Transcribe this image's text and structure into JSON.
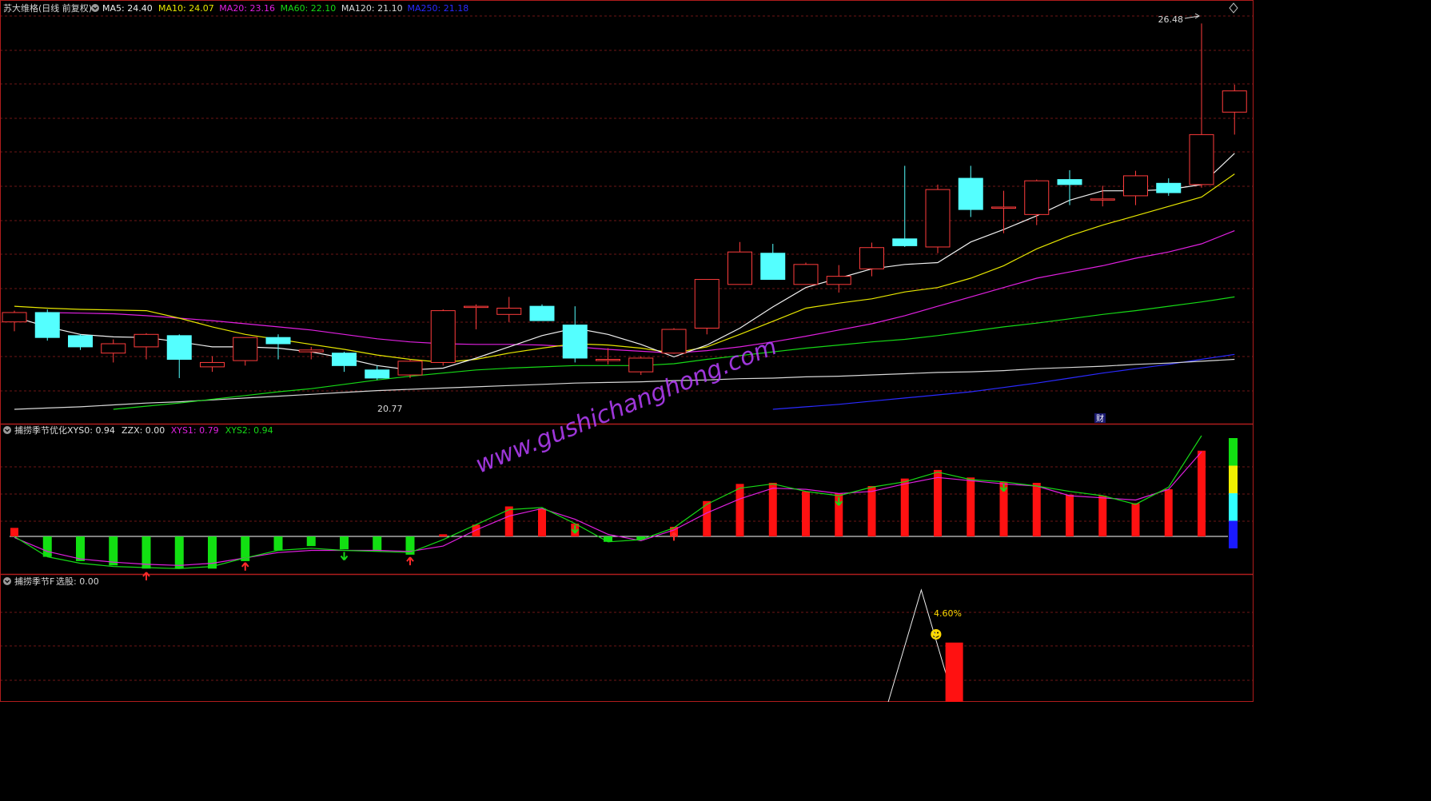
{
  "colors": {
    "background": "#000000",
    "frame": "#b01c1c",
    "grid": "#6e1616",
    "up": "#ff3c3c",
    "down": "#54ffff",
    "ma5": "#f0f0f0",
    "ma10": "#e6e600",
    "ma20": "#e020e0",
    "ma60": "#16d916",
    "ma120": "#d8d8d8",
    "ma250": "#2a2aff",
    "header": "#d8d8d8",
    "xys1": "#e020e0",
    "xys2": "#16d916",
    "green_bar": "#12e012",
    "red_bar": "#ff1111",
    "arrow_up": "#ff2a2a",
    "arrow_down": "#16d916",
    "gauge": [
      "#12e012",
      "#f0f000",
      "#30ffff",
      "#1a1aff"
    ],
    "watermark": "#b940ff",
    "smiley": "#ffd900",
    "pct": "#ffd900"
  },
  "header": {
    "name": "苏大维格(日线 前复权)",
    "ma_labels": [
      {
        "label": "MA5: 24.40",
        "color": "#f0f0f0"
      },
      {
        "label": "MA10: 24.07",
        "color": "#e6e600"
      },
      {
        "label": "MA20: 23.16",
        "color": "#e020e0"
      },
      {
        "label": "MA60: 22.10",
        "color": "#16d916"
      },
      {
        "label": "MA120: 21.10",
        "color": "#d8d8d8"
      },
      {
        "label": "MA250: 21.18",
        "color": "#2a2aff"
      }
    ]
  },
  "indicator1": {
    "name": "捕捞季节优化",
    "labels": [
      {
        "label": "XYS0: 0.94",
        "color": "#e0e0e0"
      },
      {
        "label": "ZZX: 0.00",
        "color": "#e0e0e0"
      },
      {
        "label": "XYS1: 0.79",
        "color": "#e020e0"
      },
      {
        "label": "XYS2: 0.94",
        "color": "#16d916"
      }
    ]
  },
  "indicator2": {
    "name": "捕捞季节F",
    "label": "选股: 0.00",
    "pct_label": "4.60%",
    "smiley": "☻"
  },
  "annotations": {
    "high_label": "26.48",
    "low_label": "20.77",
    "cai_badge": "财"
  },
  "watermark": "www.gushichanghong.com",
  "chart_data": [
    {
      "type": "candlestick",
      "title": "苏大维格(日线 前复权)",
      "ylim": [
        20.3,
        26.6
      ],
      "candles": [
        {
          "o": 21.7,
          "h": 21.88,
          "l": 21.55,
          "c": 21.85
        },
        {
          "o": 21.85,
          "h": 21.9,
          "l": 21.4,
          "c": 21.45
        },
        {
          "o": 21.48,
          "h": 21.5,
          "l": 21.25,
          "c": 21.3
        },
        {
          "o": 21.2,
          "h": 21.42,
          "l": 21.05,
          "c": 21.35
        },
        {
          "o": 21.3,
          "h": 21.52,
          "l": 21.1,
          "c": 21.5
        },
        {
          "o": 21.48,
          "h": 21.5,
          "l": 20.8,
          "c": 21.1
        },
        {
          "o": 20.98,
          "h": 21.15,
          "l": 20.9,
          "c": 21.05
        },
        {
          "o": 21.08,
          "h": 21.45,
          "l": 21.0,
          "c": 21.45
        },
        {
          "o": 21.45,
          "h": 21.5,
          "l": 21.1,
          "c": 21.35
        },
        {
          "o": 21.22,
          "h": 21.3,
          "l": 21.1,
          "c": 21.25
        },
        {
          "o": 21.2,
          "h": 21.22,
          "l": 20.9,
          "c": 21.0
        },
        {
          "o": 20.93,
          "h": 21.0,
          "l": 20.77,
          "c": 20.8
        },
        {
          "o": 20.85,
          "h": 21.1,
          "l": 20.8,
          "c": 21.07
        },
        {
          "o": 21.05,
          "h": 21.9,
          "l": 21.0,
          "c": 21.88
        },
        {
          "o": 21.95,
          "h": 21.98,
          "l": 21.58,
          "c": 21.95
        },
        {
          "o": 21.82,
          "h": 22.1,
          "l": 21.7,
          "c": 21.92
        },
        {
          "o": 21.95,
          "h": 21.98,
          "l": 21.72,
          "c": 21.72
        },
        {
          "o": 21.65,
          "h": 21.95,
          "l": 21.05,
          "c": 21.12
        },
        {
          "o": 21.08,
          "h": 21.28,
          "l": 21.02,
          "c": 21.1
        },
        {
          "o": 20.9,
          "h": 21.15,
          "l": 20.85,
          "c": 21.12
        },
        {
          "o": 21.2,
          "h": 21.6,
          "l": 21.2,
          "c": 21.58
        },
        {
          "o": 21.6,
          "h": 22.38,
          "l": 21.5,
          "c": 22.38
        },
        {
          "o": 22.3,
          "h": 22.98,
          "l": 22.3,
          "c": 22.82
        },
        {
          "o": 22.8,
          "h": 22.95,
          "l": 22.38,
          "c": 22.38
        },
        {
          "o": 22.3,
          "h": 22.65,
          "l": 22.3,
          "c": 22.62
        },
        {
          "o": 22.3,
          "h": 22.61,
          "l": 22.17,
          "c": 22.43
        },
        {
          "o": 22.55,
          "h": 22.97,
          "l": 22.43,
          "c": 22.89
        },
        {
          "o": 23.03,
          "h": 24.2,
          "l": 22.9,
          "c": 22.92
        },
        {
          "o": 22.9,
          "h": 23.9,
          "l": 22.8,
          "c": 23.82
        },
        {
          "o": 24.0,
          "h": 24.2,
          "l": 23.38,
          "c": 23.5
        },
        {
          "o": 23.53,
          "h": 23.8,
          "l": 23.12,
          "c": 23.54
        },
        {
          "o": 23.42,
          "h": 23.98,
          "l": 23.25,
          "c": 23.96
        },
        {
          "o": 23.98,
          "h": 24.13,
          "l": 23.57,
          "c": 23.9
        },
        {
          "o": 23.67,
          "h": 23.88,
          "l": 23.55,
          "c": 23.67
        },
        {
          "o": 23.72,
          "h": 24.12,
          "l": 23.57,
          "c": 24.04
        },
        {
          "o": 23.92,
          "h": 24.0,
          "l": 23.72,
          "c": 23.77
        },
        {
          "o": 23.9,
          "h": 26.48,
          "l": 23.85,
          "c": 24.7
        },
        {
          "o": 25.06,
          "h": 25.5,
          "l": 24.7,
          "c": 25.4
        }
      ],
      "ma5": [
        21.78,
        21.62,
        21.5,
        21.46,
        21.45,
        21.38,
        21.3,
        21.3,
        21.28,
        21.22,
        21.12,
        21.0,
        20.93,
        20.96,
        21.12,
        21.3,
        21.48,
        21.6,
        21.5,
        21.34,
        21.14,
        21.33,
        21.6,
        21.94,
        22.25,
        22.4,
        22.55,
        22.62,
        22.65,
        22.98,
        23.18,
        23.4,
        23.65,
        23.8,
        23.8,
        23.82,
        23.9,
        24.4
      ],
      "ma10": [
        21.95,
        21.92,
        21.9,
        21.89,
        21.88,
        21.76,
        21.62,
        21.5,
        21.42,
        21.34,
        21.26,
        21.17,
        21.1,
        21.05,
        21.1,
        21.2,
        21.28,
        21.35,
        21.33,
        21.28,
        21.2,
        21.3,
        21.5,
        21.71,
        21.92,
        22.0,
        22.07,
        22.18,
        22.25,
        22.4,
        22.6,
        22.87,
        23.08,
        23.25,
        23.4,
        23.55,
        23.7,
        24.07
      ],
      "ma20": [
        null,
        21.85,
        21.84,
        21.83,
        21.8,
        21.76,
        21.72,
        21.67,
        21.62,
        21.57,
        21.5,
        21.43,
        21.38,
        21.35,
        21.34,
        21.34,
        21.33,
        21.3,
        21.26,
        21.23,
        21.2,
        21.24,
        21.3,
        21.38,
        21.47,
        21.57,
        21.67,
        21.8,
        21.95,
        22.1,
        22.25,
        22.4,
        22.5,
        22.6,
        22.72,
        22.82,
        22.95,
        23.16
      ],
      "ma60": [
        null,
        null,
        null,
        20.3,
        20.35,
        20.4,
        20.46,
        20.52,
        20.58,
        20.63,
        20.7,
        20.77,
        20.83,
        20.88,
        20.93,
        20.96,
        20.98,
        21.0,
        21.0,
        21.0,
        21.03,
        21.1,
        21.16,
        21.22,
        21.28,
        21.33,
        21.38,
        21.42,
        21.48,
        21.55,
        21.62,
        21.68,
        21.75,
        21.82,
        21.88,
        21.95,
        22.02,
        22.1
      ],
      "ma120": [
        20.3,
        20.32,
        20.34,
        20.37,
        20.4,
        20.42,
        20.45,
        20.48,
        20.51,
        20.54,
        20.57,
        20.6,
        20.62,
        20.64,
        20.66,
        20.68,
        20.7,
        20.72,
        20.73,
        20.74,
        20.76,
        20.77,
        20.79,
        20.8,
        20.82,
        20.83,
        20.85,
        20.87,
        20.89,
        20.9,
        20.92,
        20.95,
        20.97,
        20.99,
        21.02,
        21.04,
        21.07,
        21.1
      ],
      "ma250": [
        null,
        null,
        null,
        null,
        null,
        null,
        null,
        null,
        null,
        null,
        null,
        null,
        null,
        null,
        null,
        null,
        null,
        null,
        null,
        null,
        null,
        null,
        null,
        20.3,
        20.34,
        20.38,
        20.43,
        20.48,
        20.53,
        20.58,
        20.65,
        20.72,
        20.8,
        20.88,
        20.95,
        21.02,
        21.1,
        21.18
      ]
    },
    {
      "type": "bar",
      "title": "捕捞季节优化",
      "ylim": [
        -0.35,
        0.94
      ],
      "bars": [
        0.08,
        -0.19,
        -0.23,
        -0.27,
        -0.3,
        -0.3,
        -0.3,
        -0.23,
        -0.13,
        -0.09,
        -0.12,
        -0.14,
        -0.17,
        0.02,
        0.11,
        0.28,
        0.26,
        0.12,
        -0.05,
        -0.03,
        0.09,
        0.33,
        0.49,
        0.5,
        0.42,
        0.4,
        0.47,
        0.54,
        0.62,
        0.55,
        0.51,
        0.5,
        0.39,
        0.38,
        0.31,
        0.44,
        0.8
      ],
      "xys1": [
        -0.01,
        -0.14,
        -0.21,
        -0.24,
        -0.26,
        -0.27,
        -0.25,
        -0.2,
        -0.15,
        -0.13,
        -0.13,
        -0.13,
        -0.14,
        -0.09,
        0.06,
        0.19,
        0.26,
        0.16,
        0.02,
        -0.04,
        0.06,
        0.22,
        0.35,
        0.45,
        0.44,
        0.4,
        0.42,
        0.49,
        0.55,
        0.52,
        0.49,
        0.47,
        0.38,
        0.36,
        0.34,
        0.44,
        0.79
      ],
      "xys2": [
        0.0,
        -0.19,
        -0.25,
        -0.28,
        -0.29,
        -0.3,
        -0.28,
        -0.2,
        -0.13,
        -0.11,
        -0.13,
        -0.14,
        -0.15,
        -0.03,
        0.11,
        0.25,
        0.27,
        0.12,
        -0.05,
        -0.03,
        0.08,
        0.3,
        0.45,
        0.49,
        0.42,
        0.38,
        0.46,
        0.51,
        0.6,
        0.53,
        0.51,
        0.47,
        0.42,
        0.38,
        0.3,
        0.46,
        0.94
      ],
      "arrows": [
        {
          "i": 4,
          "dir": "up"
        },
        {
          "i": 7,
          "dir": "up"
        },
        {
          "i": 10,
          "dir": "down"
        },
        {
          "i": 12,
          "dir": "up"
        },
        {
          "i": 17,
          "dir": "down"
        },
        {
          "i": 20,
          "dir": "up"
        },
        {
          "i": 25,
          "dir": "down"
        },
        {
          "i": 30,
          "dir": "down"
        }
      ]
    },
    {
      "type": "line",
      "title": "捕捞季节F",
      "ylim": [
        0,
        1
      ],
      "line": [
        {
          "i": 26.5,
          "v": 0
        },
        {
          "i": 27.5,
          "v": 1
        },
        {
          "i": 28.5,
          "v": 0
        }
      ],
      "bar": {
        "i": 28.5,
        "v": 0.53
      }
    }
  ]
}
